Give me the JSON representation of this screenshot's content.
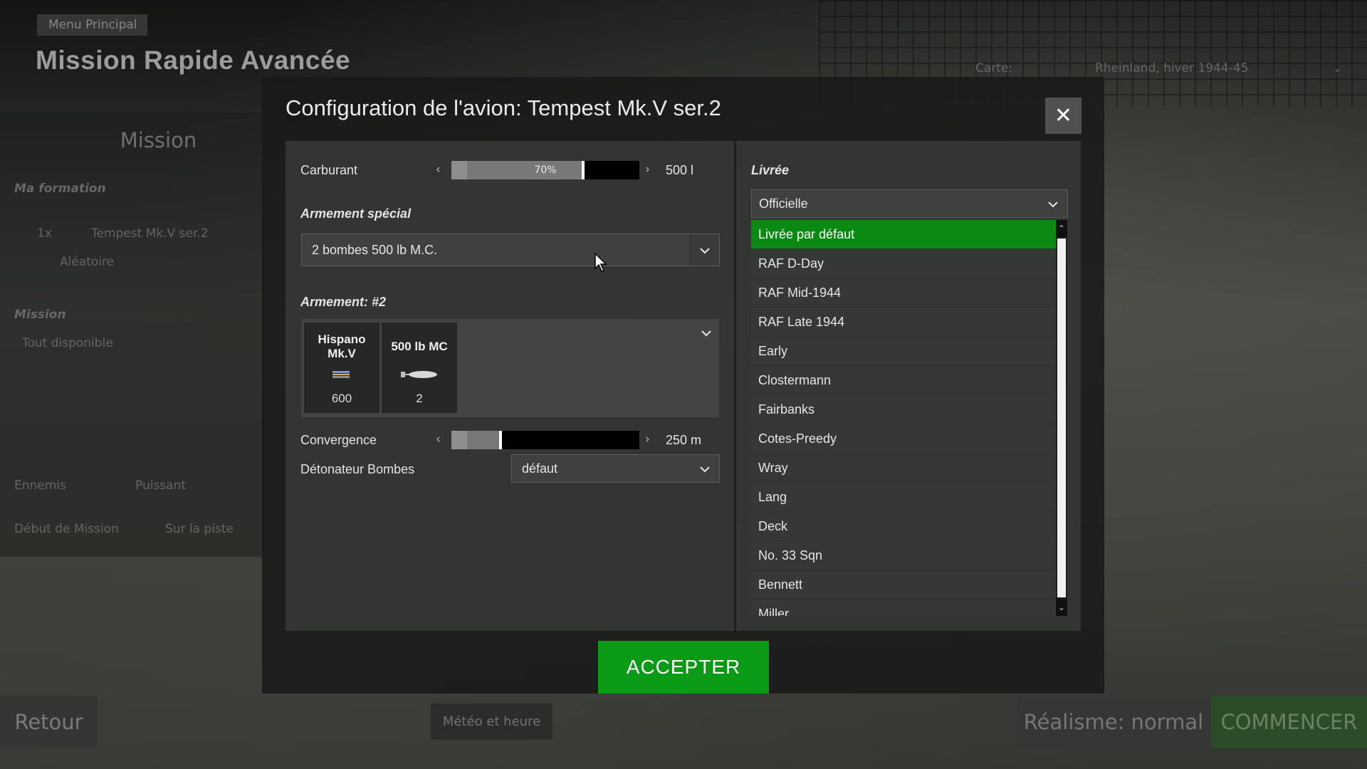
{
  "background": {
    "breadcrumb": "Menu Principal",
    "page_title": "Mission Rapide Avancée",
    "map_label": "Carte:",
    "map_value": "Rheinland, hiver 1944-45",
    "left_panel": {
      "heading": "Mission",
      "formation_label": "Ma formation",
      "formation_count": "1x",
      "formation_aircraft": "Tempest Mk.V ser.2",
      "formation_option": "Aléatoire",
      "mission_label": "Mission",
      "mission_value": "Tout disponible",
      "enemies_label": "Ennemis",
      "enemies_value": "Puissant",
      "start_label": "Début de Mission",
      "start_value": "Sur la piste"
    },
    "bottom": {
      "back": "Retour",
      "weather": "Météo et heure",
      "realism": "Réalisme: normal",
      "start": "COMMENCER"
    }
  },
  "modal": {
    "title": "Configuration de l'avion: Tempest Mk.V ser.2",
    "close_icon": "close-icon",
    "fuel": {
      "label": "Carburant",
      "percent_text": "70%",
      "fraction": 0.7,
      "value": "500 l"
    },
    "special_armament": {
      "label": "Armement spécial",
      "selected": "2 bombes 500 lb M.C."
    },
    "armament": {
      "label": "Armement: #2",
      "weapons": [
        {
          "name": "Hispano Mk.V",
          "count": "600",
          "icon": "cannon-shell-icon"
        },
        {
          "name": "500 lb MC",
          "count": "2",
          "icon": "bomb-icon"
        }
      ]
    },
    "convergence": {
      "label": "Convergence",
      "fraction": 0.26,
      "value": "250 m"
    },
    "bomb_fuze": {
      "label": "Détonateur Bombes",
      "selected": "défaut"
    },
    "livery": {
      "label": "Livrée",
      "filter": "Officielle",
      "items": [
        "Livrée par défaut",
        "RAF D-Day",
        "RAF Mid-1944",
        "RAF Late 1944",
        "Early",
        "Clostermann",
        "Fairbanks",
        "Cotes-Preedy",
        "Wray",
        "Lang",
        "Deck",
        "No. 33 Sqn",
        "Bennett",
        "Miller"
      ],
      "selected_index": 0
    },
    "accept": "ACCEPTER"
  },
  "colors": {
    "accent_green": "#0b9a16",
    "selected_row": "#0a8a12"
  }
}
